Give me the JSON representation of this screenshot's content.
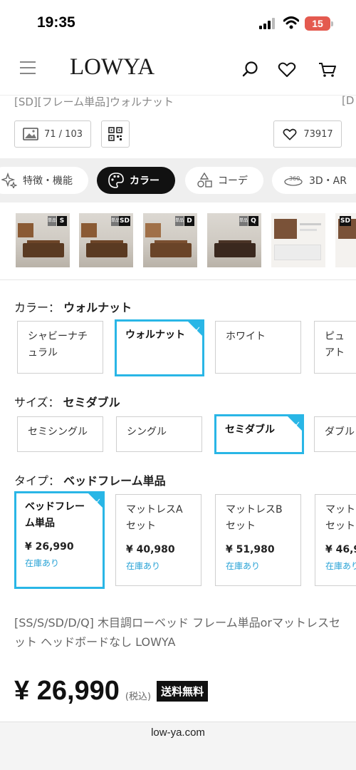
{
  "status": {
    "time": "19:35",
    "battery": "15"
  },
  "header": {
    "logo": "LOWYA"
  },
  "title_cut": "[SD][フレーム単品]ウォルナット",
  "title_cut_right": "[D",
  "actions": {
    "image_count": "71 / 103",
    "favorites": "73917"
  },
  "tabs": [
    {
      "label": "特徴・機能"
    },
    {
      "label": "カラー"
    },
    {
      "label": "コーデ"
    },
    {
      "label": "3D・AR"
    }
  ],
  "thumb_tags": [
    "S",
    "SD",
    "D",
    "Q",
    "SD"
  ],
  "thumb_tag_small": "単品",
  "color": {
    "label": "カラー：",
    "selected": "ウォルナット",
    "options": [
      "シャビーナチュラル",
      "ウォルナット",
      "ホワイト",
      "ピュアト"
    ]
  },
  "size": {
    "label": "サイズ：",
    "selected": "セミダブル",
    "options": [
      "セミシングル",
      "シングル",
      "セミダブル",
      "ダブル"
    ]
  },
  "type": {
    "label": "タイプ：",
    "selected": "ベッドフレーム単品",
    "options": [
      {
        "name": "ベッドフレーム単品",
        "price": "¥ 26,990",
        "stock": "在庫あり"
      },
      {
        "name": "マットレスAセット",
        "price": "¥ 40,980",
        "stock": "在庫あり"
      },
      {
        "name": "マットレスBセット",
        "price": "¥ 51,980",
        "stock": "在庫あり"
      },
      {
        "name": "マットセット",
        "price": "¥ 46,9",
        "stock": "在庫あり"
      }
    ]
  },
  "product": {
    "name": "[SS/S/SD/D/Q] 木目調ローベッド フレーム単品orマットレスセット ヘッドボードなし LOWYA",
    "price": "¥ 26,990",
    "tax": "(税込)",
    "shipping": "送料無料"
  },
  "browser": {
    "url": "low-ya.com"
  },
  "colors": {
    "accent": "#29b6e6",
    "stock": "#29a3d6",
    "battery": "#e45a4f"
  }
}
